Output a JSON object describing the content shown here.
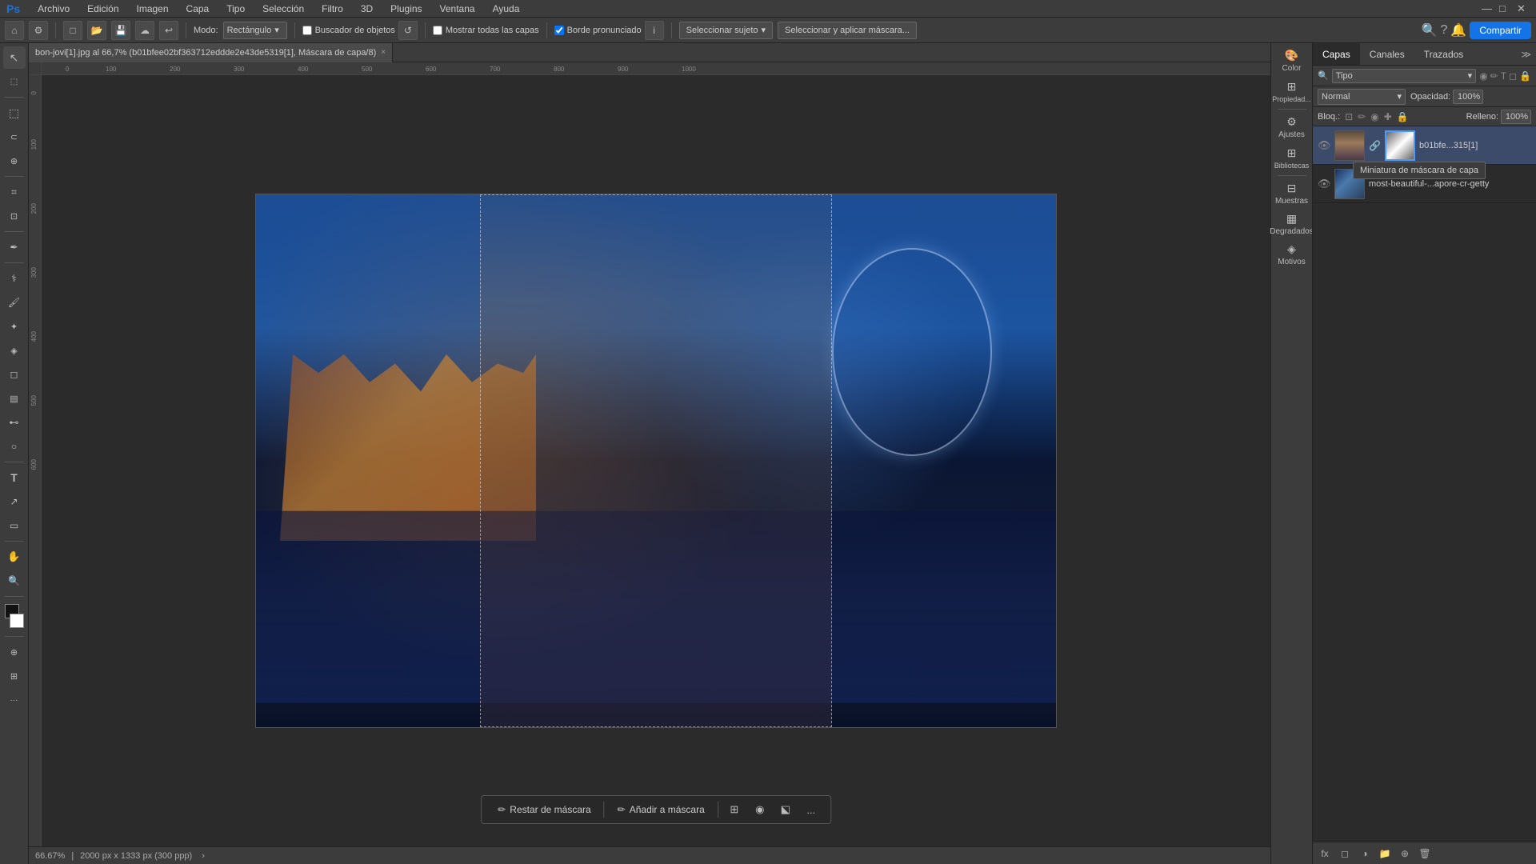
{
  "menubar": {
    "items": [
      "Archivo",
      "Edición",
      "Imagen",
      "Capa",
      "Tipo",
      "Selección",
      "Filtro",
      "3D",
      "Plugins",
      "Ventana",
      "Ayuda"
    ]
  },
  "options": {
    "tool_icon": "◎",
    "mode_label": "Modo:",
    "mode_value": "Rectángulo",
    "find_subject_label": "Buscador de objetos",
    "show_all_layers_label": "Mostrar todas las capas",
    "refine_edge_label": "Borde pronunciado",
    "select_subject_label": "Seleccionar sujeto",
    "select_mask_label": "Seleccionar y aplicar máscara...",
    "share_label": "Compartir"
  },
  "tab": {
    "title": "bon-jovi[1].jpg al 66,7% (b01bfee02bf363712eddde2e43de5319[1], Máscara de capa/8)",
    "close": "×"
  },
  "canvas": {
    "zoom": "66.67%",
    "dimensions": "2000 px x 1333 px (300 ppp)"
  },
  "mask_toolbar": {
    "subtract_label": "Restar de máscara",
    "add_label": "Añadir a máscara",
    "more_label": "..."
  },
  "right_panel": {
    "items": [
      {
        "icon": "🎨",
        "label": "Color"
      },
      {
        "icon": "⊞",
        "label": "Propiedad..."
      },
      {
        "icon": "⚙",
        "label": "Ajustes"
      },
      {
        "icon": "⊞",
        "label": "Bibliotecas"
      },
      {
        "icon": "⊟",
        "label": "Muestras"
      },
      {
        "icon": "▦",
        "label": "Degradados"
      },
      {
        "icon": "◈",
        "label": "Motivos"
      }
    ]
  },
  "layers": {
    "tabs": [
      "Capas",
      "Canales",
      "Trazados"
    ],
    "active_tab": "Capas",
    "search_placeholder": "Tipo",
    "blend_mode": "Normal",
    "opacity_label": "Opacidad:",
    "opacity_value": "100%",
    "lock_label": "Bloq.:",
    "fill_label": "Relleno:",
    "fill_value": "100%",
    "layers": [
      {
        "name": "b01bfe...315[1]",
        "visible": true,
        "has_mask": true,
        "active": true
      },
      {
        "name": "most-beautiful-...apore-cr-getty",
        "visible": true,
        "has_mask": false,
        "active": false
      }
    ],
    "tooltip": "Miniatura de máscara de capa",
    "footer_icons": [
      "fx",
      "◻",
      "🎨",
      "📁",
      "⊕",
      "🗑"
    ]
  },
  "tools": {
    "items": [
      {
        "icon": "↖",
        "name": "move-tool"
      },
      {
        "icon": "◰",
        "name": "artboard-tool"
      },
      {
        "icon": "⬚",
        "name": "marquee-tool"
      },
      {
        "icon": "⬡",
        "name": "lasso-tool"
      },
      {
        "icon": "⊕",
        "name": "quick-select-tool"
      },
      {
        "icon": "✂",
        "name": "crop-tool"
      },
      {
        "icon": "⊷",
        "name": "frame-tool"
      },
      {
        "icon": "⊿",
        "name": "eyedropper-tool"
      },
      {
        "icon": "✒",
        "name": "spot-heal-tool"
      },
      {
        "icon": "⊠",
        "name": "brush-tool"
      },
      {
        "icon": "⊡",
        "name": "clone-tool"
      },
      {
        "icon": "⊞",
        "name": "history-tool"
      },
      {
        "icon": "◉",
        "name": "eraser-tool"
      },
      {
        "icon": "⬕",
        "name": "gradient-tool"
      },
      {
        "icon": "⊷",
        "name": "blur-tool"
      },
      {
        "icon": "⊗",
        "name": "dodge-tool"
      },
      {
        "icon": "T",
        "name": "type-tool"
      },
      {
        "icon": "↗",
        "name": "path-tool"
      },
      {
        "icon": "▭",
        "name": "shape-tool"
      },
      {
        "icon": "✋",
        "name": "hand-tool"
      },
      {
        "icon": "🔍",
        "name": "zoom-tool"
      }
    ]
  }
}
